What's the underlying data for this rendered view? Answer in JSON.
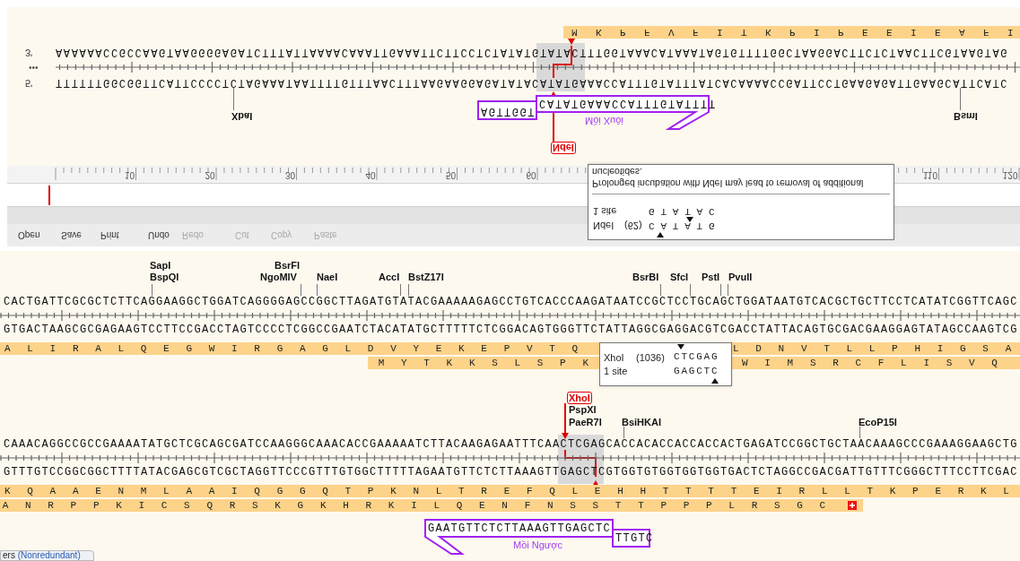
{
  "sequence_view": {
    "toolbar": [
      {
        "label": "Open",
        "disabled": false
      },
      {
        "label": "Save",
        "disabled": false
      },
      {
        "label": "Print",
        "disabled": false
      },
      {
        "label": "Undo",
        "disabled": false
      },
      {
        "label": "Redo",
        "disabled": true
      },
      {
        "label": "Cut",
        "disabled": true
      },
      {
        "label": "Copy",
        "disabled": true
      },
      {
        "label": "Paste",
        "disabled": true
      }
    ],
    "ruler_labels": [
      "10",
      "20",
      "30",
      "40",
      "50",
      "60",
      "110",
      "120"
    ],
    "tooltip": {
      "enzyme": "NdeI",
      "position": "(62)",
      "sites": "1 site",
      "top_site": "CATATG",
      "bottom_site": "GTATAC",
      "note_lines": [
        "nucleotides.",
        "Prolonged incubation with NdeI may lead to removal of additional"
      ]
    },
    "enzymes": [
      {
        "name": "NdeI",
        "selected": true
      },
      {
        "name": "XbaI",
        "selected": false
      },
      {
        "name": "BsmI",
        "selected": false
      }
    ],
    "primer": {
      "name": "Mồi Xuôi",
      "tail": "AGTTGGT",
      "body": "CATATGAAACCATTTGTATTTT"
    },
    "top_strand": {
      "end": "5'",
      "sequence": "TTTTTTGGCGGTTCATTCCCCTCTAGAAATAATTTTGTTTAACTTTAAGAAGGAGATATACATATGAAACCATTTGTATTTATCACAAAACCGATTCCTGAAGAGATTGAAGCATTCATC"
    },
    "ellipsis": "•••",
    "bottom_strand": {
      "end": "3'",
      "sequence": "AAAAAACCGCCAAGTAAGGGGAGATCTTTATTAAAACAAATTGAAATTCTTCCTCTATATGTATACTTTGGTAAACATAAATAGTGTTTTGGCTAAGGACTTCTCTAACTTCGTAAGTAG"
    },
    "translations": [
      {
        "segments": [
          "M K P F V F I T K P I P E E I E A F I"
        ]
      }
    ]
  },
  "map_view": {
    "blocks": [
      {
        "enzymes": [
          {
            "name": "SapI",
            "selected": false
          },
          {
            "name": "BsrFI",
            "selected": false
          },
          {
            "name": "BspQI",
            "selected": false
          },
          {
            "name": "NgoMIV",
            "selected": false
          },
          {
            "name": "NaeI",
            "selected": false
          },
          {
            "name": "AccI",
            "selected": false
          },
          {
            "name": "BstZ17I",
            "selected": false
          },
          {
            "name": "BsrBI",
            "selected": false
          },
          {
            "name": "SfcI",
            "selected": false
          },
          {
            "name": "PstI",
            "selected": false
          },
          {
            "name": "PvuII",
            "selected": false
          }
        ],
        "top_strand": "CACTGATTCGCGCTCTTCAGGAAGGCTGGATCAGGGGAGCCGGCTTAGATGTATACGAAAAAGAGCCTGTCACCCAAGATAATCCGCTCCTGCAGCTGGATAATGTCACGCTGCTTCCTCATATCGGTTCAGC",
        "bottom_strand": "GTGACTAAGCGCGAGAAGTCCTTCCGACCTAGTCCCCTCGGCCGAATCTACATATGCTTTTTCTCGGACAGTGGGTTCTATTAGGCGAGGACGTCGACCTATTACAGTGCGACGAAGGAGTATAGCCAAGTCG",
        "translations": [
          {
            "segments": [
              "A L I R A L Q E G W I R G A G L D V Y E K E P V T Q",
              "L D N V T L L P H I G S A"
            ],
            "stop_codon": false
          },
          {
            "segments": [
              "M Y T K K S L S P K",
              "W I M S R C F L I S V Q"
            ],
            "stop_codon": false
          }
        ],
        "tooltip": {
          "enzyme": "XhoI",
          "position": "(1036)",
          "sites": "1 site",
          "top_site": "CTCGAG",
          "bottom_site": "GAGCTC"
        }
      },
      {
        "enzymes": [
          {
            "name": "XhoI",
            "selected": true
          },
          {
            "name": "PspXI",
            "selected": false
          },
          {
            "name": "PaeR7I",
            "selected": false
          },
          {
            "name": "BsiHKAI",
            "selected": false
          },
          {
            "name": "EcoP15I",
            "selected": false
          }
        ],
        "top_strand": "CAAACAGGCCGCCGAAAATATGCTCGCAGCGATCCAAGGGCAAACACCGAAAAATCTTACAAGAGAATTTCAACTCGAGCACCACACCACCACCACTGAGATCCGGCTGCTAACAAAGCCCGAAAGGAAGCTG",
        "bottom_strand": "GTTTGTCCGGCGGCTTTTATACGAGCGTCGCTAGGTTCCCGTTTGTGGCTTTTTAGAATGTTCTCTTAAAGTTGAGCTCGTGGTGTGGTGGTGGTGACTCTAGGCCGACGATTGTTTCGGGCTTTCCTTCGAC",
        "translations": [
          {
            "segments": [
              "K Q A A E N M L A A I Q G G Q T P K N L T R E F Q L E H H T T T T E I R L L T K P E R K L"
            ],
            "stop_codon": false
          },
          {
            "segments": [
              "A N R P P K I C S Q R S K G K H R K I L Q E N F N S S T T P P P L R S G C"
            ],
            "stop_codon": true
          }
        ]
      }
    ],
    "primer": {
      "name": "Mồi Ngược",
      "body": "GAATGTTCTCTTAAAGTTGAGCTC",
      "tail": "TTGTC"
    },
    "tab": {
      "label": "ers",
      "qualifier": "(Nonredundant)"
    }
  }
}
